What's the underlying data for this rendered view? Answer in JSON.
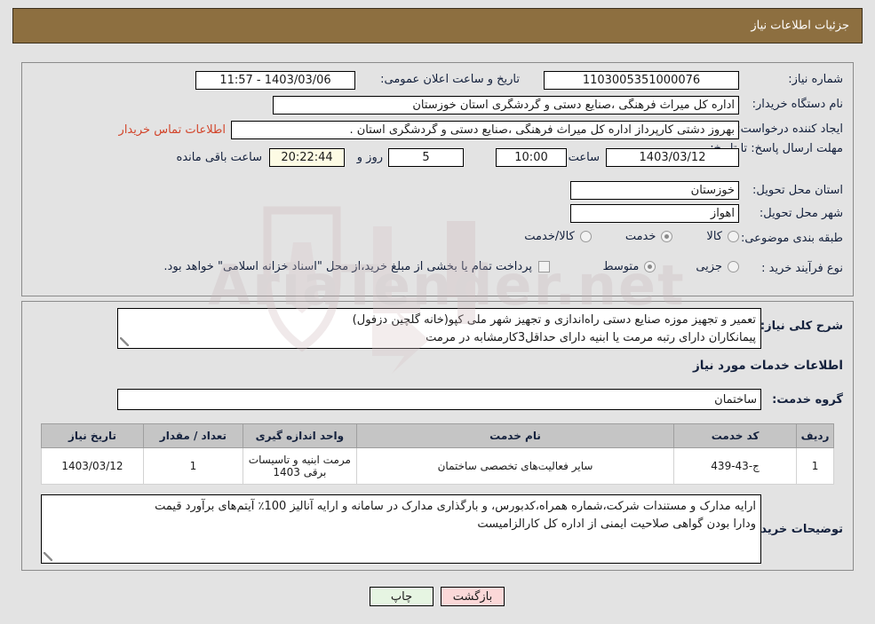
{
  "header": {
    "title": "جزئیات اطلاعات نیاز"
  },
  "form": {
    "need_number_label": "شماره نیاز:",
    "need_number_value": "1103005351000076",
    "announce_datetime_label": "تاریخ و ساعت اعلان عمومی:",
    "announce_datetime_value": "1403/03/06 - 11:57",
    "buyer_org_label": "نام دستگاه خریدار:",
    "buyer_org_value": "اداره کل میراث فرهنگی ،صنایع دستی و گردشگری استان خوزستان",
    "requester_label": "ایجاد کننده درخواست:",
    "requester_value": "بهروز دشتی کارپرداز اداره کل میراث فرهنگی ،صنایع دستی و گردشگری استان .",
    "buyer_contact_link": "اطلاعات تماس خریدار",
    "deadline_label": "مهلت ارسال پاسخ: تا تاریخ:",
    "deadline_date": "1403/03/12",
    "deadline_hour_label": "ساعت",
    "deadline_hour_value": "10:00",
    "remaining_days_value": "5",
    "remaining_days_label": "روز و",
    "remaining_time_value": "20:22:44",
    "remaining_time_label": "ساعت باقی مانده",
    "province_label": "استان محل تحویل:",
    "province_value": "خوزستان",
    "city_label": "شهر محل تحویل:",
    "city_value": "اهواز",
    "category_label": "طبقه بندی موضوعی:",
    "category_options": [
      {
        "label": "کالا",
        "selected": false
      },
      {
        "label": "خدمت",
        "selected": true
      },
      {
        "label": "کالا/خدمت",
        "selected": false
      }
    ],
    "process_type_label": "نوع فرآیند خرید :",
    "process_type_options": [
      {
        "label": "جزیی",
        "selected": false
      },
      {
        "label": "متوسط",
        "selected": true
      }
    ],
    "treasury_checkbox_label": "پرداخت تمام یا بخشی از مبلغ خرید،از محل \"اسناد خزانه اسلامی\" خواهد بود.",
    "treasury_checkbox_checked": false
  },
  "description": {
    "label": "شرح کلی نیاز:",
    "value": "تعمیر و تجهیز موزه صنایع دستی راه‌اندازی و تجهیز شهر ملی کپو(خانه گلچین دزفول)\nپیمانکاران دارای رتبه مرمت  یا ابنیه دارای حداقل3کارمشابه در مرمت"
  },
  "services_section": {
    "heading": "اطلاعات خدمات مورد نیاز",
    "group_label": "گروه خدمت:",
    "group_value": "ساختمان"
  },
  "table": {
    "columns": [
      "ردیف",
      "کد خدمت",
      "نام خدمت",
      "واحد اندازه گیری",
      "تعداد / مقدار",
      "تاریخ نیاز"
    ],
    "rows": [
      {
        "row_no": "1",
        "service_code": "ج-43-439",
        "service_name": "سایر فعالیت‌های تخصصی ساختمان",
        "unit": "مرمت ابنیه و تاسیسات برقی 1403",
        "quantity": "1",
        "need_date": "1403/03/12"
      }
    ]
  },
  "buyer_notes": {
    "label": "توضیحات خریدار:",
    "value": "ارایه مدارک و مستندات شرکت،شماره همراه،کدبورس، و بارگذاری مدارک در سامانه و ارایه آنالیز 100٪ آیتم‌های برآورد قیمت\nودارا بودن گواهی صلاحیت ایمنی از اداره کل کارالزامیست"
  },
  "footer": {
    "print_label": "چاپ",
    "back_label": "بازگشت"
  },
  "watermark": {
    "text": "AriaTender.net"
  },
  "colors": {
    "header_bg": "#8d6f40",
    "link": "#d2452b",
    "label": "#14213d",
    "timer_bg": "#fdfbe4",
    "print_btn_bg": "#e6f5e2",
    "back_btn_bg": "#fbd8d8",
    "table_header_bg": "#c5c5c5",
    "page_bg": "#e3e3e3"
  }
}
